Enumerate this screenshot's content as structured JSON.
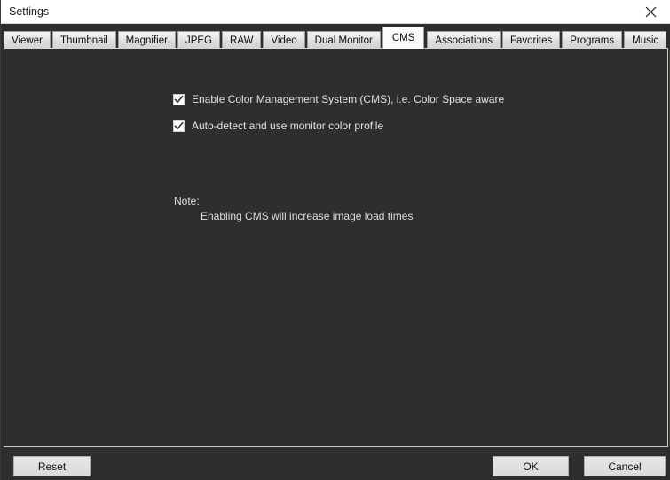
{
  "window": {
    "title": "Settings",
    "close_icon": "close-icon"
  },
  "tabs": [
    {
      "label": "Viewer",
      "selected": false
    },
    {
      "label": "Thumbnail",
      "selected": false
    },
    {
      "label": "Magnifier",
      "selected": false
    },
    {
      "label": "JPEG",
      "selected": false
    },
    {
      "label": "RAW",
      "selected": false
    },
    {
      "label": "Video",
      "selected": false
    },
    {
      "label": "Dual Monitor",
      "selected": false
    },
    {
      "label": "CMS",
      "selected": true
    },
    {
      "label": "Associations",
      "selected": false
    },
    {
      "label": "Favorites",
      "selected": false
    },
    {
      "label": "Programs",
      "selected": false
    },
    {
      "label": "Music",
      "selected": false
    }
  ],
  "cms_panel": {
    "options": [
      {
        "label": "Enable Color Management System (CMS), i.e. Color Space aware",
        "checked": true
      },
      {
        "label": "Auto-detect and use monitor color profile",
        "checked": true
      }
    ],
    "note_title": "Note:",
    "note_body": "Enabling CMS will increase image load times"
  },
  "footer": {
    "reset_label": "Reset",
    "ok_label": "OK",
    "cancel_label": "Cancel"
  },
  "colors": {
    "window_background": "#2e2e2e",
    "titlebar_background": "#ffffff",
    "text_primary": "#e2e2e2",
    "tab_background": "#dcdcdc",
    "tab_selected_background": "#fbfbfb",
    "button_background": "#e1e1e1"
  }
}
